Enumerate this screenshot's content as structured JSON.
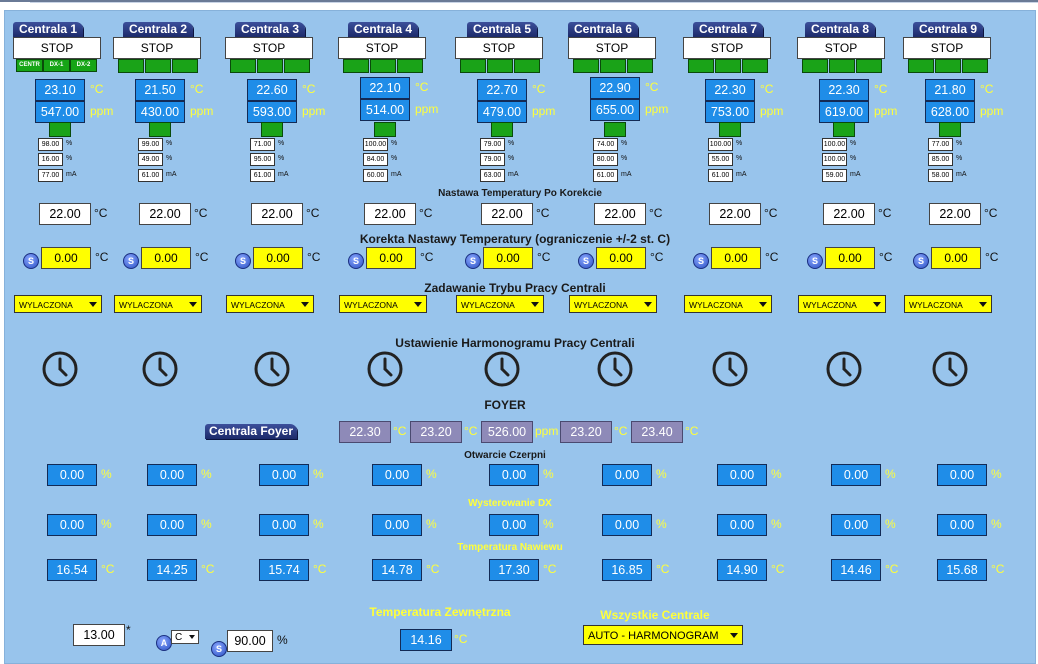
{
  "units": {
    "temp": "°C",
    "ppm": "ppm",
    "pct": "%",
    "ma": "mA"
  },
  "centrale": [
    {
      "name": "Centrala 1",
      "status": "STOP",
      "badges": [
        "CENTR",
        "DX-1",
        "DX-2"
      ],
      "temp": "23.10",
      "ppm": "547.00",
      "pct1": "98.00",
      "pct2": "16.00",
      "ma": "77.00",
      "setpoint": "22.00",
      "correction": "0.00",
      "mode": "WYLACZONA",
      "otwarcie": "0.00",
      "dx": "0.00",
      "nawiew": "16.54"
    },
    {
      "name": "Centrala 2",
      "status": "STOP",
      "temp": "21.50",
      "ppm": "430.00",
      "pct1": "99.00",
      "pct2": "49.00",
      "ma": "61.00",
      "setpoint": "22.00",
      "correction": "0.00",
      "mode": "WYLACZONA",
      "otwarcie": "0.00",
      "dx": "0.00",
      "nawiew": "14.25"
    },
    {
      "name": "Centrala 3",
      "status": "STOP",
      "temp": "22.60",
      "ppm": "593.00",
      "pct1": "71.00",
      "pct2": "95.00",
      "ma": "61.00",
      "setpoint": "22.00",
      "correction": "0.00",
      "mode": "WYLACZONA",
      "otwarcie": "0.00",
      "dx": "0.00",
      "nawiew": "15.74"
    },
    {
      "name": "Centrala 4",
      "status": "STOP",
      "temp": "22.10",
      "ppm": "514.00",
      "pct1": "100.00",
      "pct2": "84.00",
      "ma": "60.00",
      "setpoint": "22.00",
      "correction": "0.00",
      "mode": "WYLACZONA",
      "otwarcie": "0.00",
      "dx": "0.00",
      "nawiew": "14.78"
    },
    {
      "name": "Centrala 5",
      "status": "STOP",
      "temp": "22.70",
      "ppm": "479.00",
      "pct1": "79.00",
      "pct2": "79.00",
      "ma": "63.00",
      "setpoint": "22.00",
      "correction": "0.00",
      "mode": "WYLACZONA",
      "otwarcie": "0.00",
      "dx": "0.00",
      "nawiew": "17.30"
    },
    {
      "name": "Centrala 6",
      "status": "STOP",
      "temp": "22.90",
      "ppm": "655.00",
      "pct1": "74.00",
      "pct2": "80.00",
      "ma": "61.00",
      "setpoint": "22.00",
      "correction": "0.00",
      "mode": "WYLACZONA",
      "otwarcie": "0.00",
      "dx": "0.00",
      "nawiew": "16.85"
    },
    {
      "name": "Centrala 7",
      "status": "STOP",
      "temp": "22.30",
      "ppm": "753.00",
      "pct1": "100.00",
      "pct2": "55.00",
      "ma": "61.00",
      "setpoint": "22.00",
      "correction": "0.00",
      "mode": "WYLACZONA",
      "otwarcie": "0.00",
      "dx": "0.00",
      "nawiew": "14.90"
    },
    {
      "name": "Centrala 8",
      "status": "STOP",
      "temp": "22.30",
      "ppm": "619.00",
      "pct1": "100.00",
      "pct2": "100.00",
      "ma": "59.00",
      "setpoint": "22.00",
      "correction": "0.00",
      "mode": "WYLACZONA",
      "otwarcie": "0.00",
      "dx": "0.00",
      "nawiew": "14.46"
    },
    {
      "name": "Centrala 9",
      "status": "STOP",
      "temp": "21.80",
      "ppm": "628.00",
      "pct1": "77.00",
      "pct2": "85.00",
      "ma": "58.00",
      "setpoint": "22.00",
      "correction": "0.00",
      "mode": "WYLACZONA",
      "otwarcie": "0.00",
      "dx": "0.00",
      "nawiew": "15.68"
    }
  ],
  "headings": {
    "setpoint": "Nastawa Temperatury Po Korekcie",
    "correction": "Korekta Nastawy Temperatury (ograniczenie +/-2 st. C)",
    "mode": "Zadawanie Trybu Pracy Centrali",
    "schedule": "Ustawienie Harmonogramu Pracy Centrali",
    "foyer": "FOYER",
    "otwarcie": "Otwarcie Czerpni",
    "dx": "Wysterowanie DX",
    "nawiew": "Temperatura Nawiewu",
    "outside": "Temperatura Zewnętrzna",
    "all": "Wszystkie Centrale"
  },
  "s_icon": "S",
  "a_icon": "A",
  "foyer": {
    "tab": "Centrala Foyer",
    "v1": "22.30",
    "v2": "23.20",
    "v3": "526.00",
    "v4": "23.20",
    "v5": "23.40"
  },
  "bottom": {
    "input_value": "13.00",
    "star": "*",
    "unit_select": "C",
    "pct_input": "90.00",
    "outside_temp": "14.16",
    "all_mode": "AUTO - HARMONOGRAM"
  }
}
